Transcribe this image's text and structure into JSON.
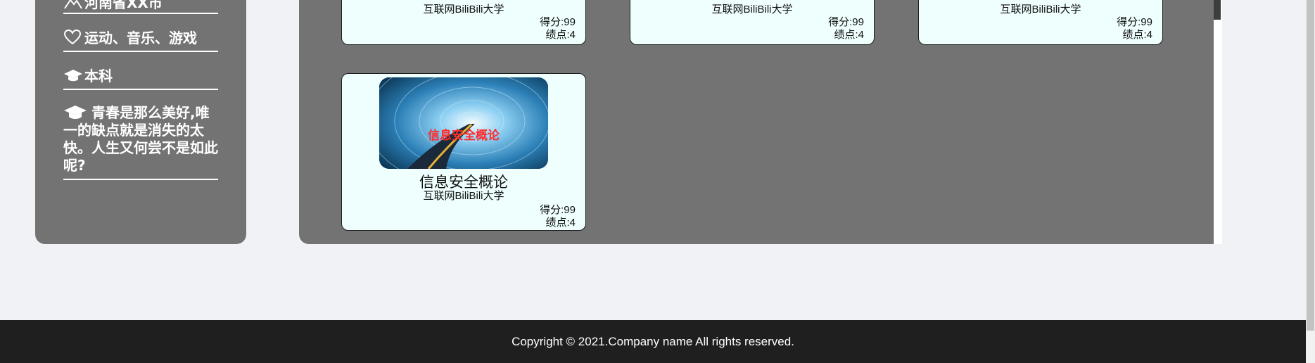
{
  "sidebar": {
    "location": "河南省XX市",
    "hobbies": "运动、音乐、游戏",
    "education": "本科",
    "motto": "青春是那么美好,唯一的缺点就是消失的太快。人生又何尝不是如此呢?"
  },
  "courses": [
    {
      "university": "互联网BiliBili大学",
      "score": "得分:99",
      "gpa": "绩点:4"
    },
    {
      "university": "互联网BiliBili大学",
      "score": "得分:99",
      "gpa": "绩点:4"
    },
    {
      "university": "互联网BiliBili大学",
      "score": "得分:99",
      "gpa": "绩点:4"
    },
    {
      "thumbnail_text": "信息安全概论",
      "name": "信息安全概论",
      "university": "互联网BiliBili大学",
      "score": "得分:99",
      "gpa": "绩点:4"
    }
  ],
  "footer": {
    "copyright": "Copyright © 2021.Company name All rights reserved."
  },
  "colors": {
    "panel": "#737373",
    "card": "#eefffe",
    "footer": "#1f1f1f",
    "thumb_text": "#ff2a2a"
  }
}
